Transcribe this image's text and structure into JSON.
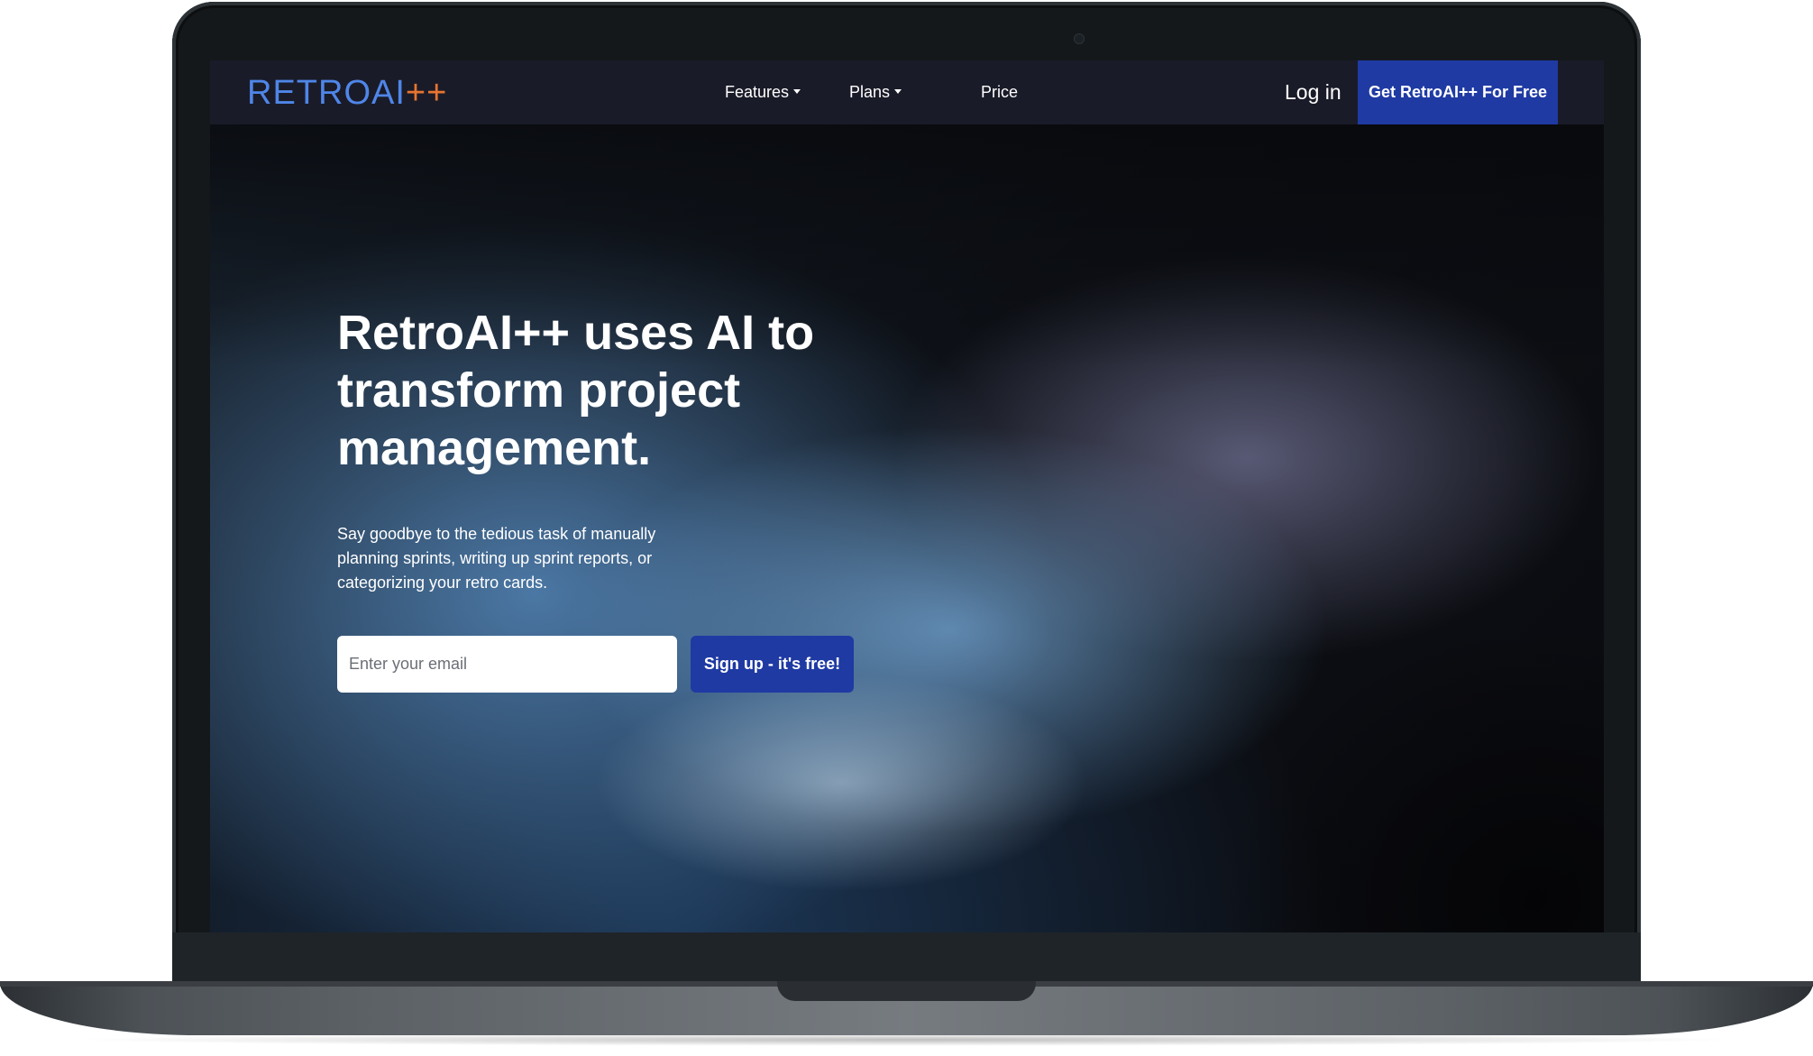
{
  "brand": {
    "logo_main": "RETROAI",
    "logo_suffix": "++",
    "logo_main_color": "#4f86e8",
    "logo_suffix_color": "#e8742f"
  },
  "nav": {
    "items": [
      {
        "label": "Features",
        "has_dropdown": true
      },
      {
        "label": "Plans",
        "has_dropdown": true
      },
      {
        "label": "Price",
        "has_dropdown": false
      }
    ],
    "login_label": "Log in",
    "cta_label": "Get RetroAI++ For Free",
    "cta_color": "#1f3aa3"
  },
  "hero": {
    "headline": "RetroAI++ uses AI to transform project management.",
    "subtext": "Say goodbye to the tedious task of manually planning sprints, writing up sprint reports, or categorizing your retro cards.",
    "email_placeholder": "Enter your email",
    "signup_label": "Sign up - it's free!",
    "signup_color": "#1f3aa3"
  },
  "device": {
    "camera_icon": "camera-dot-icon"
  }
}
